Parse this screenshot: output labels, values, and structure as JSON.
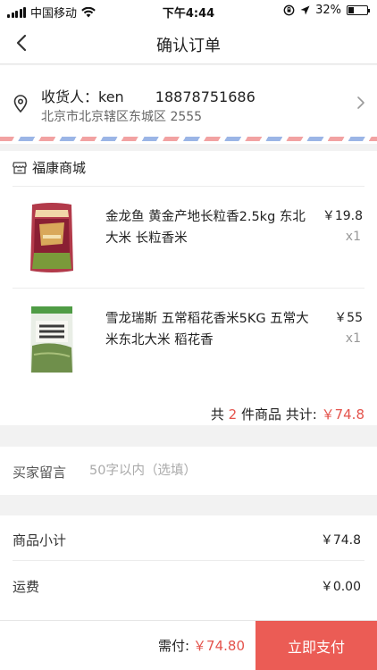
{
  "status": {
    "carrier": "中国移动",
    "time": "下午4:44",
    "battery": "32%",
    "battery_level": 0.32
  },
  "nav": {
    "title": "确认订单",
    "back_icon": "chevron-left-icon"
  },
  "address": {
    "receiver_label": "收货人：",
    "receiver_name": "ken",
    "phone": "18878751686",
    "detail": "北京市北京辖区东城区 2555"
  },
  "store": {
    "name": "福康商城",
    "products": [
      {
        "title": "金龙鱼 黄金产地长粒香2.5kg 东北大米 长粒香米",
        "price": "￥19.8",
        "qty": "x1"
      },
      {
        "title": "雪龙瑞斯 五常稻花香米5KG 五常大米东北大米 稻花香",
        "price": "￥55",
        "qty": "x1"
      }
    ],
    "summary": {
      "prefix": "共",
      "count": "2",
      "middle": "件商品 共计:",
      "total": "￥74.8"
    }
  },
  "message": {
    "label": "买家留言",
    "placeholder": "50字以内（选填）"
  },
  "costs": {
    "subtotal_label": "商品小计",
    "subtotal_value": "￥74.8",
    "shipping_label": "运费",
    "shipping_value": "￥0.00"
  },
  "bottom": {
    "need_label": "需付:",
    "need_amount": "￥74.80",
    "pay_label": "立即支付"
  },
  "colors": {
    "accent": "#eb5c55",
    "price_red": "#e4534c"
  }
}
